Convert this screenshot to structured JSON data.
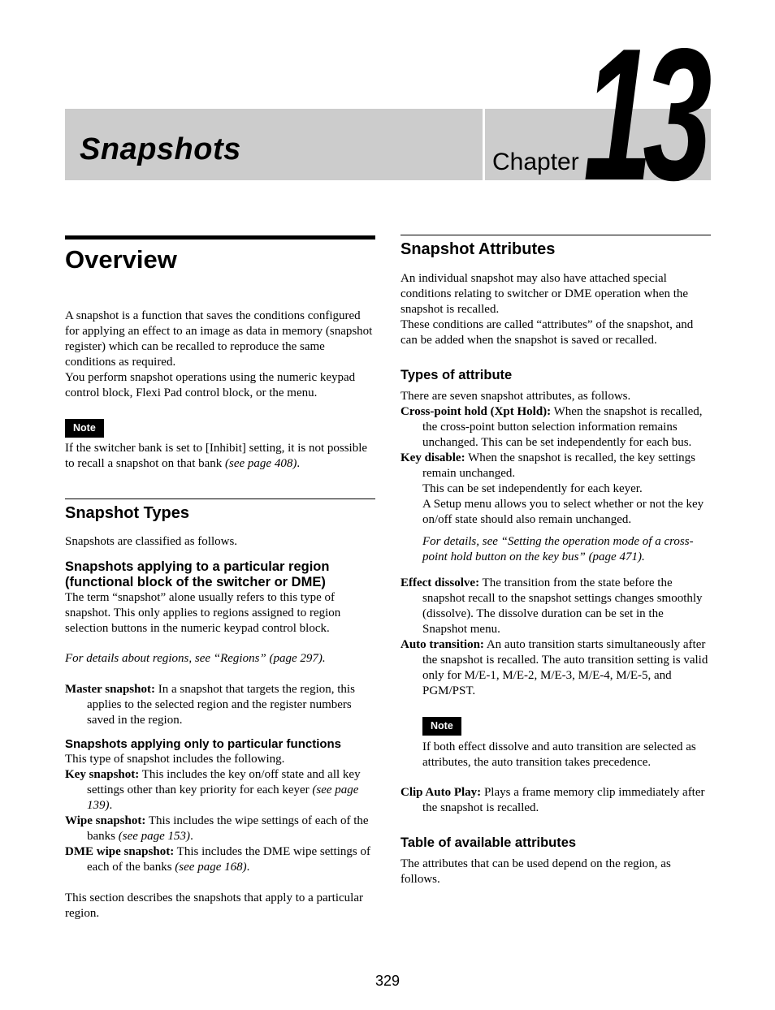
{
  "header": {
    "chapter_title": "Snapshots",
    "chapter_label": "Chapter",
    "chapter_number": "13",
    "band_color": "#cccccc"
  },
  "left": {
    "overview": {
      "heading": "Overview",
      "para1": "A snapshot is a function that saves the conditions configured for applying an effect to an image as data in memory (snapshot register) which can be recalled to reproduce the same conditions as required.",
      "para2": "You perform snapshot operations using the numeric keypad control block, Flexi Pad control block, or the menu.",
      "note_label": "Note",
      "note_text": "If the switcher bank is set to [Inhibit] setting, it is not possible to recall a snapshot on that bank ",
      "note_ref": "(see page 408)",
      "note_end": "."
    },
    "types": {
      "heading": "Snapshot Types",
      "intro": "Snapshots are classified as follows.",
      "region_heading": "Snapshots applying to a particular region (functional block of the switcher or DME)",
      "region_text": "The term “snapshot” alone usually refers to this type of snapshot. This only applies to regions assigned to region selection buttons in the numeric keypad control block.",
      "region_ref": "For details about regions, see “Regions” (page 297).",
      "master_term": "Master snapshot:",
      "master_text": " In a snapshot that targets the region, this applies to the selected region and the register numbers saved in the region.",
      "functions_heading": "Snapshots applying only to particular functions",
      "functions_intro": "This type of snapshot includes the following.",
      "items": [
        {
          "term": "Key snapshot:",
          "text": " This includes the key on/off state and all key settings other than key priority for each keyer ",
          "ref": "(see page 139)",
          "end": "."
        },
        {
          "term": "Wipe snapshot:",
          "text": " This includes the wipe settings of each of the banks ",
          "ref": "(see page 153)",
          "end": "."
        },
        {
          "term": "DME wipe snapshot:",
          "text": " This includes the DME wipe settings of each of the banks ",
          "ref": "(see page 168)",
          "end": "."
        }
      ],
      "closing": "This section describes the snapshots that apply to a particular region."
    }
  },
  "right": {
    "attributes": {
      "heading": "Snapshot Attributes",
      "para1": "An individual snapshot may also have attached special conditions relating to switcher or DME operation when the snapshot is recalled.",
      "para2": "These conditions are called “attributes” of the snapshot, and can be added when the snapshot is saved or recalled."
    },
    "types_of_attribute": {
      "heading": "Types of attribute",
      "intro": "There are seven snapshot attributes, as follows.",
      "xpt_term": "Cross-point hold (Xpt Hold):",
      "xpt_text": " When the snapshot is recalled, the cross-point button selection information remains unchanged. This can be set independently for each bus.",
      "key_term": "Key disable:",
      "key_text": " When the snapshot is recalled, the key settings remain unchanged.",
      "key_line2": "This can be set independently for each keyer.",
      "key_line3": "A Setup menu allows you to select whether or not the key on/off state should also remain unchanged.",
      "key_ref": "For details, see “Setting the operation mode of a cross-point hold button on the key bus” (page 471).",
      "effect_term": "Effect dissolve:",
      "effect_text": " The transition from the state before the snapshot recall to the snapshot settings changes smoothly (dissolve). The dissolve duration can be set in the Snapshot menu.",
      "auto_term": "Auto transition:",
      "auto_text": " An auto transition starts simultaneously after the snapshot is recalled. The auto transition setting is valid only for M/E-1, M/E-2, M/E-3, M/E-4, M/E-5, and PGM/PST.",
      "note_label": "Note",
      "note_text": "If both effect dissolve and auto transition are selected as attributes, the auto transition takes precedence.",
      "clip_term": "Clip Auto Play:",
      "clip_text": " Plays a frame memory clip immediately after the snapshot is recalled."
    },
    "table_section": {
      "heading": "Table of available attributes",
      "text": "The attributes that can be used depend on the region, as follows."
    }
  },
  "footer": {
    "page_number": "329"
  }
}
